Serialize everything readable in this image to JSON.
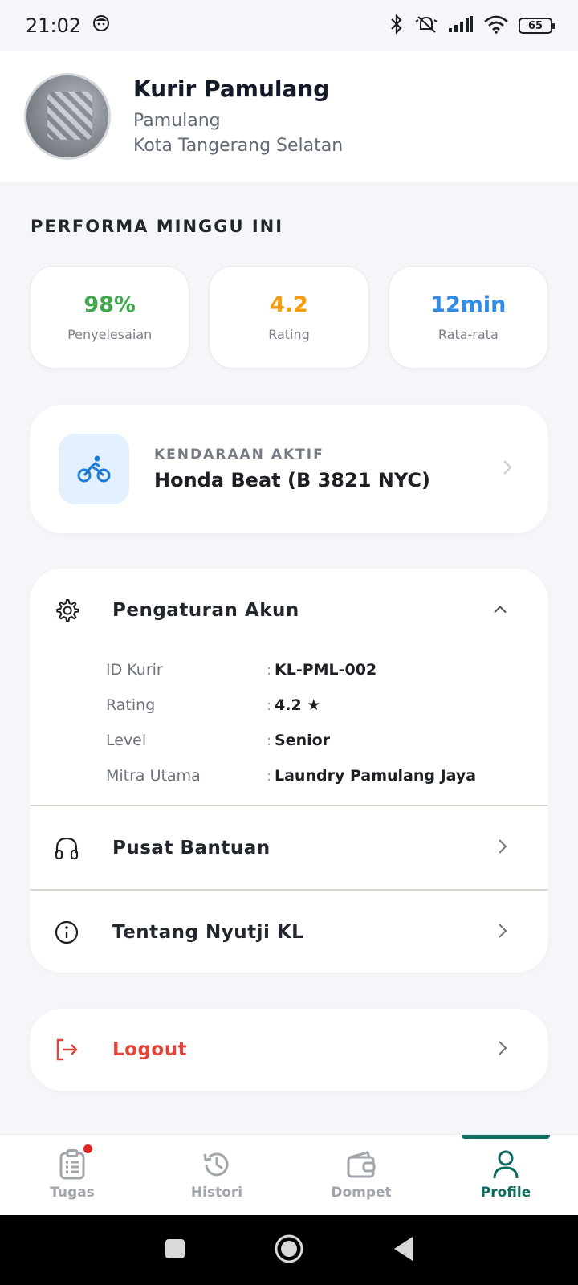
{
  "status_bar": {
    "time": "21:02",
    "battery": "65"
  },
  "profile": {
    "name": "Kurir Pamulang",
    "area": "Pamulang",
    "city": "Kota Tangerang Selatan"
  },
  "performance": {
    "title": "PERFORMA MINGGU INI",
    "stats": [
      {
        "value": "98%",
        "label": "Penyelesaian",
        "color": "#3ea84a"
      },
      {
        "value": "4.2",
        "label": "Rating",
        "color": "#f59d0b"
      },
      {
        "value": "12min",
        "label": "Rata-rata",
        "color": "#2f8be6"
      }
    ]
  },
  "vehicle": {
    "label": "KENDARAAN AKTIF",
    "name": "Honda Beat (B 3821 NYC)"
  },
  "settings": {
    "account_label": "Pengaturan Akun",
    "details": [
      {
        "key": "ID Kurir",
        "value": "KL-PML-002"
      },
      {
        "key": "Rating",
        "value": "4.2 ★"
      },
      {
        "key": "Level",
        "value": "Senior"
      },
      {
        "key": "Mitra Utama",
        "value": "Laundry Pamulang Jaya"
      }
    ],
    "help_label": "Pusat Bantuan",
    "about_label": "Tentang Nyutji KL"
  },
  "logout": {
    "label": "Logout"
  },
  "bottom_nav": [
    {
      "label": "Tugas",
      "icon": "clipboard-icon",
      "active": false,
      "badge": true
    },
    {
      "label": "Histori",
      "icon": "history-icon",
      "active": false
    },
    {
      "label": "Dompet",
      "icon": "wallet-icon",
      "active": false
    },
    {
      "label": "Profile",
      "icon": "user-icon",
      "active": true
    }
  ],
  "colors": {
    "accent": "#0e6b60",
    "danger": "#e0443a",
    "vehicle_icon": "#1f7bd8"
  }
}
